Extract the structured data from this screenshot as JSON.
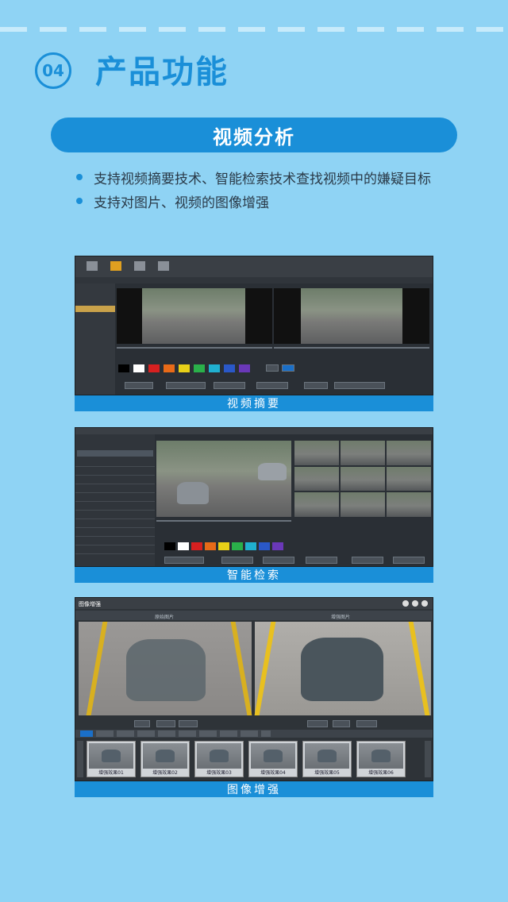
{
  "header": {
    "number": "04",
    "title": "产品功能"
  },
  "banner": {
    "title": "视频分析"
  },
  "bullets": [
    "支持视频摘要技术、智能检索技术查找视频中的嫌疑目标",
    "支持对图片、视频的图像增强"
  ],
  "captions": {
    "summary": "视频摘要",
    "search": "智能检索",
    "enhance": "图像增强"
  },
  "enhance_ui": {
    "window_title": "图像增强",
    "left_label": "原始图片",
    "right_label": "增强图片",
    "thumbs": [
      "增强效果01",
      "增强效果02",
      "增强效果03",
      "增强效果04",
      "增强效果05",
      "增强效果06"
    ]
  },
  "colors": {
    "accent": "#1a8fd8",
    "background": "#8fd3f4"
  }
}
